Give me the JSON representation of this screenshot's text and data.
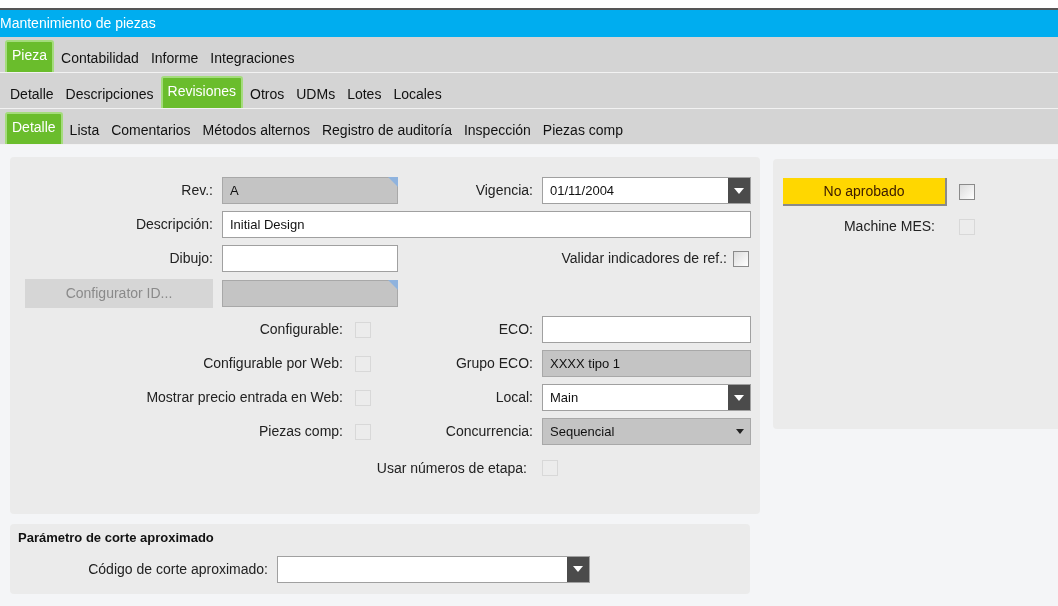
{
  "window": {
    "title": "Mantenimiento de piezas"
  },
  "tab_rows": [
    [
      {
        "label": "Pieza",
        "selected": true
      },
      {
        "label": "Contabilidad",
        "selected": false
      },
      {
        "label": "Informe",
        "selected": false
      },
      {
        "label": "Integraciones",
        "selected": false
      }
    ],
    [
      {
        "label": "Detalle",
        "selected": false
      },
      {
        "label": "Descripciones",
        "selected": false
      },
      {
        "label": "Revisiones",
        "selected": true
      },
      {
        "label": "Otros",
        "selected": false
      },
      {
        "label": "UDMs",
        "selected": false
      },
      {
        "label": "Lotes",
        "selected": false
      },
      {
        "label": "Locales",
        "selected": false
      }
    ],
    [
      {
        "label": "Detalle",
        "selected": true
      },
      {
        "label": "Lista",
        "selected": false
      },
      {
        "label": "Comentarios",
        "selected": false
      },
      {
        "label": "Métodos alternos",
        "selected": false
      },
      {
        "label": "Registro de auditoría",
        "selected": false
      },
      {
        "label": "Inspección",
        "selected": false
      },
      {
        "label": "Piezas comp",
        "selected": false
      }
    ]
  ],
  "form": {
    "rev": {
      "label": "Rev.:",
      "value": "A",
      "disabled": true
    },
    "vigencia": {
      "label": "Vigencia:",
      "value": "01/11/2004",
      "disabled": false
    },
    "descripcion": {
      "label": "Descripción:",
      "value": "Initial Design",
      "disabled": false
    },
    "dibujo": {
      "label": "Dibujo:",
      "disabled": false
    },
    "validar": {
      "label": "Validar indicadores de ref.:",
      "checked": false,
      "disabled": false
    },
    "configurator": {
      "button": "Configurator ID...",
      "disabled": true
    },
    "checkbox_rows": [
      {
        "label": "Configurable:",
        "checked": false,
        "disabled": true
      },
      {
        "label": "Configurable por Web:",
        "checked": false,
        "disabled": true
      },
      {
        "label": "Mostrar precio entrada en Web:",
        "checked": false,
        "disabled": true
      },
      {
        "label": "Piezas comp:",
        "checked": false,
        "disabled": true
      }
    ],
    "right_fields": [
      {
        "label": "ECO:",
        "kind": "text",
        "disabled": false
      },
      {
        "label": "Grupo ECO:",
        "kind": "text",
        "value": "XXXX tipo 1",
        "disabled": true
      },
      {
        "label": "Local:",
        "kind": "combo",
        "value": "Main",
        "disabled": false
      },
      {
        "label": "Concurrencia:",
        "kind": "select",
        "value": "Sequencial",
        "disabled": true
      }
    ],
    "usar": {
      "label": "Usar números de etapa:",
      "checked": false,
      "disabled": true
    }
  },
  "status": {
    "button": "No aprobado",
    "checked": false,
    "disabled": false,
    "machine_mes": {
      "label": "Machine MES:",
      "checked": false,
      "disabled": true
    }
  },
  "corte": {
    "title": "Parámetro de corte aproximado",
    "label": "Código de corte aproximado:",
    "disabled": false
  }
}
